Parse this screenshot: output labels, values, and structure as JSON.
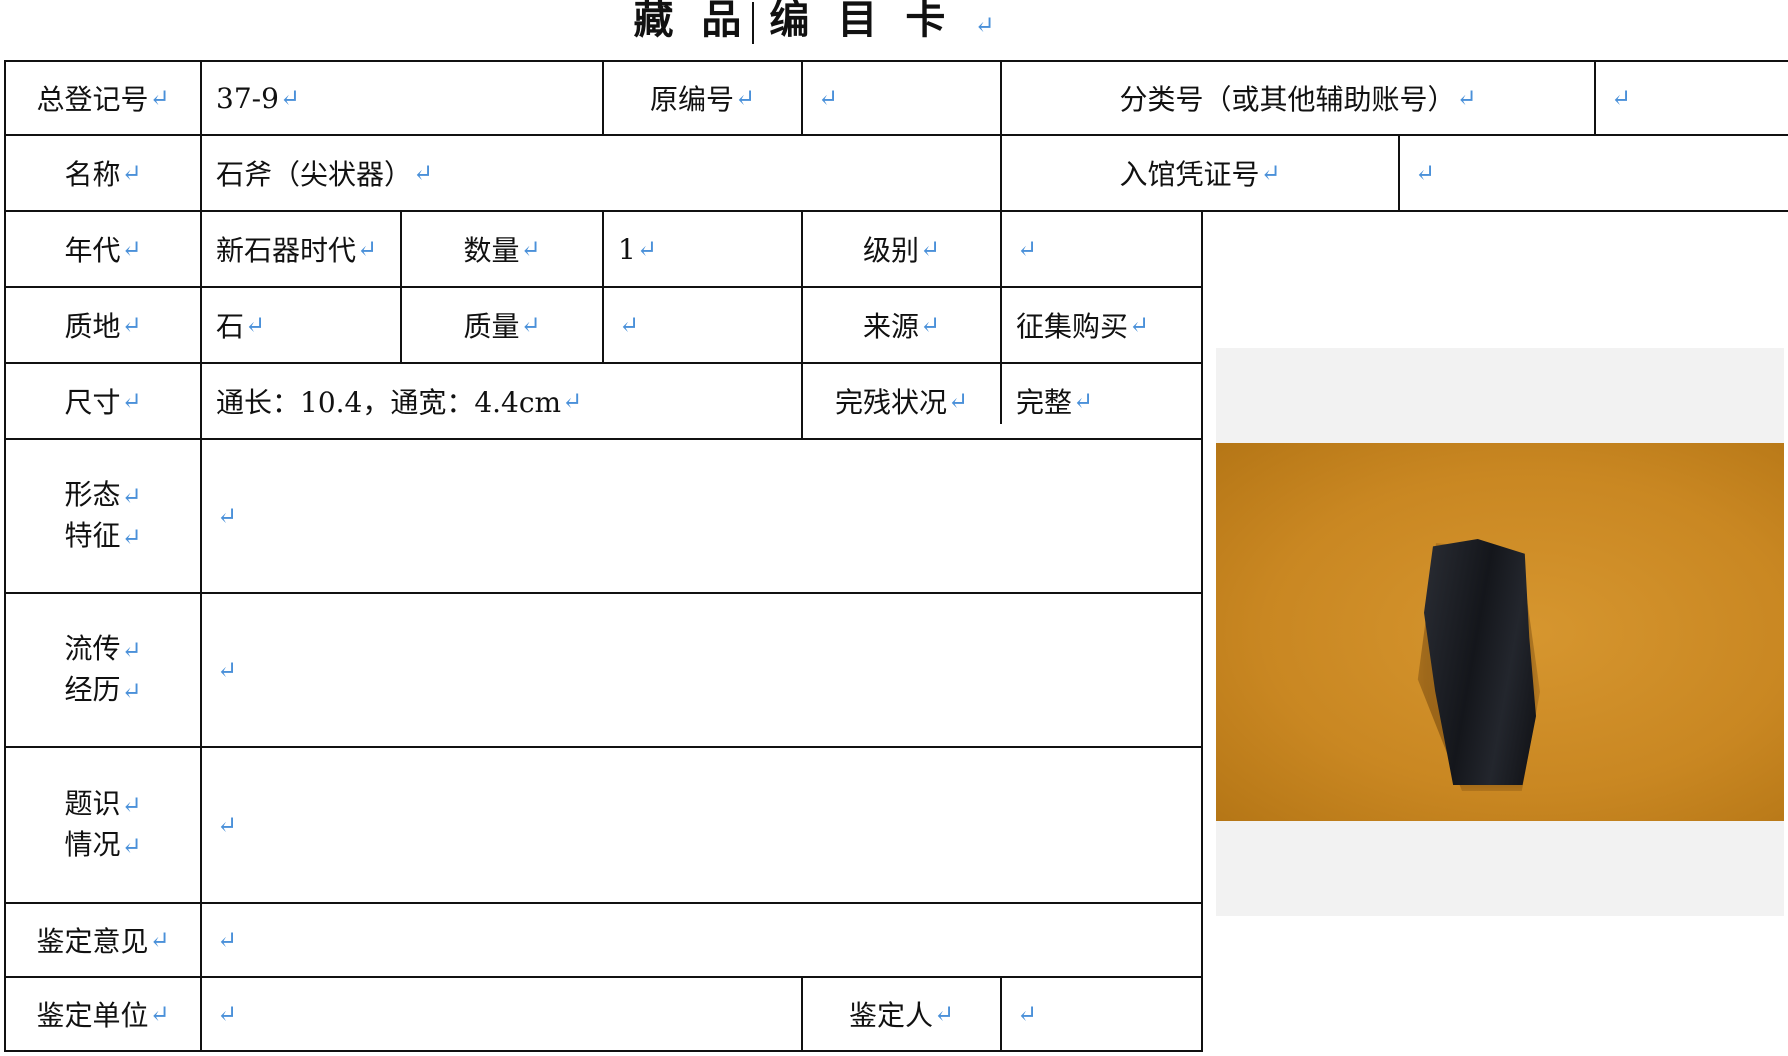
{
  "card": {
    "title": "藏品编目卡",
    "para_mark": "↵"
  },
  "labels": {
    "total_reg_no": "总登记号",
    "original_no": "原编号",
    "class_no": "分类号（或其他辅助账号）",
    "name": "名称",
    "entry_cert_no": "入馆凭证号",
    "era": "年代",
    "quantity": "数量",
    "grade": "级别",
    "material": "质地",
    "mass": "质量",
    "source": "来源",
    "size": "尺寸",
    "condition": "完残状况",
    "shape_1": "形态",
    "shape_2": "特征",
    "history_1": "流传",
    "history_2": "经历",
    "inscr_1": "题识",
    "inscr_2": "情况",
    "appraisal_opinion": "鉴定意见",
    "appraisal_unit": "鉴定单位",
    "appraiser": "鉴定人"
  },
  "values": {
    "total_reg_no": "37-9",
    "original_no": "",
    "class_no": "",
    "name": "石斧（尖状器）",
    "entry_cert_no": "",
    "era": "新石器时代",
    "quantity": "1",
    "grade": "",
    "material": "石",
    "mass": "",
    "source": "征集购买",
    "size": "通长：10.4，通宽：4.4cm",
    "condition": "完整",
    "shape": "",
    "history": "",
    "inscription": "",
    "appraisal_opinion": "",
    "appraisal_unit": "",
    "appraiser": ""
  }
}
